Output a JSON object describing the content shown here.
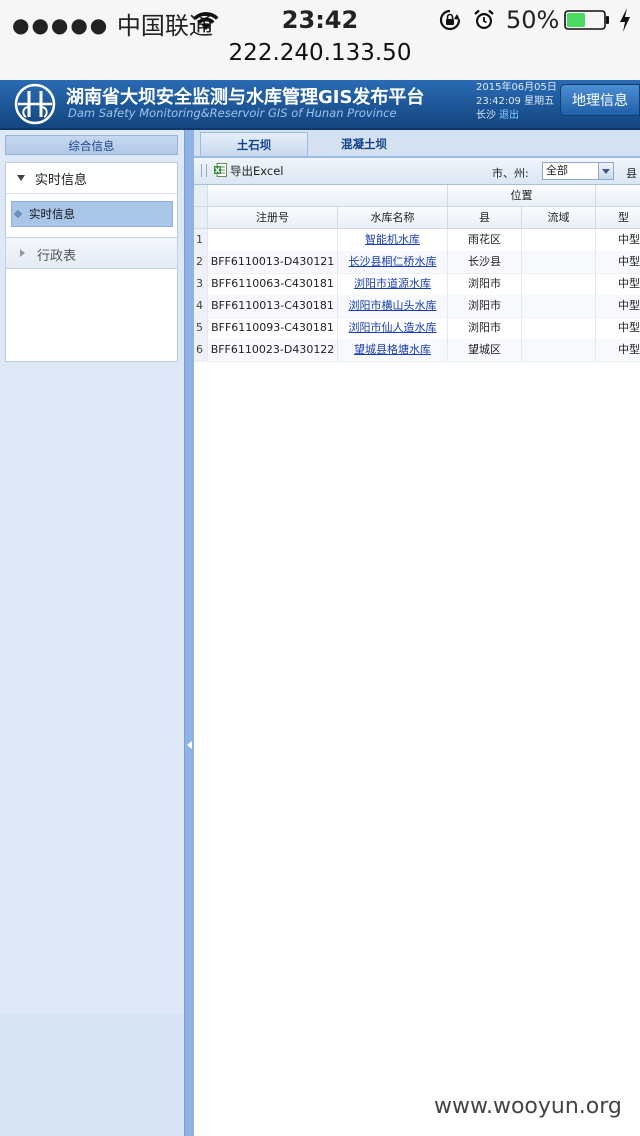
{
  "status_bar": {
    "signal_dots": "●●●●●",
    "carrier": "中国联通",
    "time": "23:42",
    "battery_percent": "50%",
    "battery_level": 0.5,
    "battery_color": "#4cd964",
    "icons": [
      "wifi-icon",
      "rotation-lock-icon",
      "alarm-icon",
      "battery-icon",
      "charging-bolt-icon"
    ]
  },
  "url": "222.240.133.50",
  "header": {
    "title": "湖南省大坝安全监测与水库管理GIS发布平台",
    "subtitle": "Dam Safety Monitoring&Reservoir GIS of Hunan Province",
    "date": "2015年06月05日",
    "datetime": "23:42:09 星期五",
    "city": "长沙",
    "logout": "退出",
    "geo_button": "地理信息",
    "brand_color": "#1e5aa0"
  },
  "sidebar": {
    "header": "综合信息",
    "sections": [
      {
        "label": "实时信息",
        "expanded": true,
        "items": [
          {
            "label": "实时信息",
            "selected": true
          }
        ]
      },
      {
        "label": "行政表",
        "expanded": false
      }
    ]
  },
  "tabs": [
    {
      "label": "土石坝",
      "active": true
    },
    {
      "label": "混凝土坝",
      "active": false
    }
  ],
  "toolbar": {
    "export_label": "导出Excel",
    "city_label": "市、州:",
    "city_value": "全部",
    "county_label": "县"
  },
  "grid": {
    "group_header": "位置",
    "columns": [
      "注册号",
      "水库名称",
      "县",
      "流域",
      "型"
    ],
    "rows": [
      {
        "n": "1",
        "reg": "",
        "name": "智能机水库",
        "county": "雨花区",
        "basin": "",
        "type": "中型"
      },
      {
        "n": "2",
        "reg": "BFF6110013-D430121",
        "name": "长沙县桐仁桥水库",
        "county": "长沙县",
        "basin": "",
        "type": "中型"
      },
      {
        "n": "3",
        "reg": "BFF6110063-C430181",
        "name": "浏阳市道源水库",
        "county": "浏阳市",
        "basin": "",
        "type": "中型"
      },
      {
        "n": "4",
        "reg": "BFF6110013-C430181",
        "name": "浏阳市横山头水库",
        "county": "浏阳市",
        "basin": "",
        "type": "中型"
      },
      {
        "n": "5",
        "reg": "BFF6110093-C430181",
        "name": "浏阳市仙人造水库",
        "county": "浏阳市",
        "basin": "",
        "type": "中型"
      },
      {
        "n": "6",
        "reg": "BFF6110023-D430122",
        "name": "望城县格塘水库",
        "county": "望城区",
        "basin": "",
        "type": "中型"
      }
    ]
  },
  "watermark": "www.wooyun.org"
}
